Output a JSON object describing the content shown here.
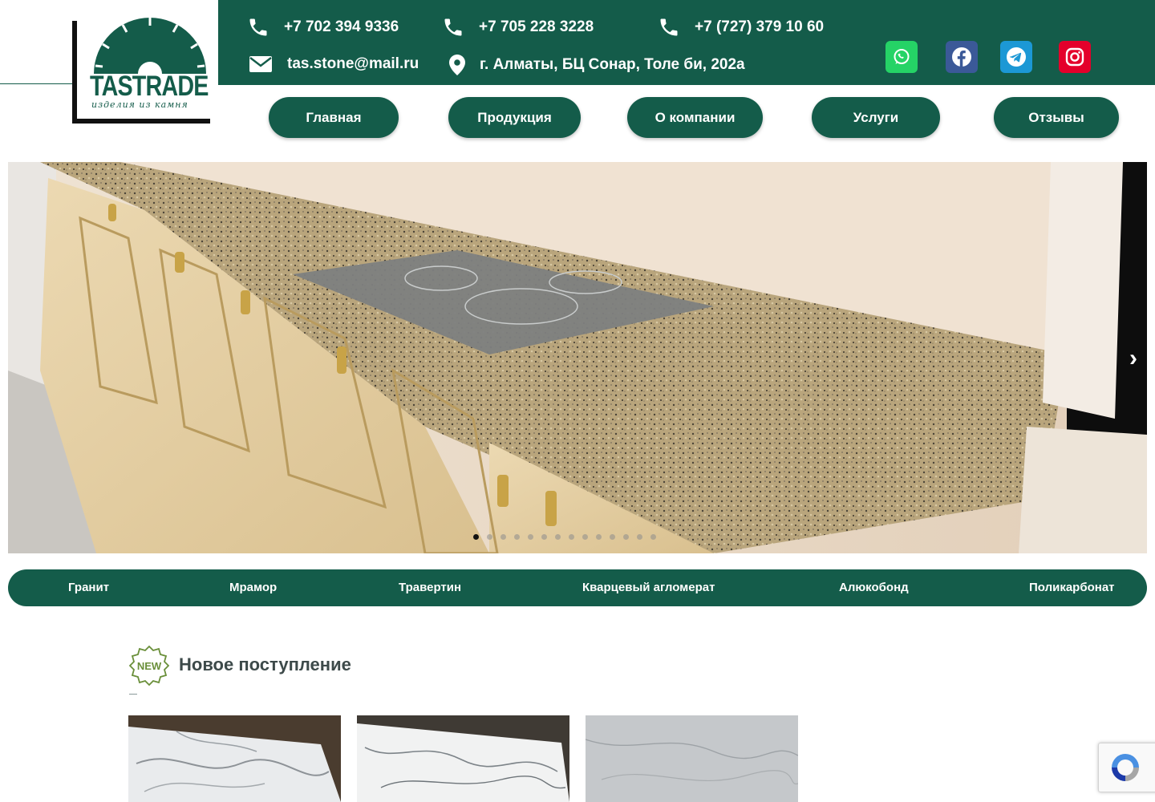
{
  "logo": {
    "brand": "TASTRADE",
    "tagline": "изделия из камня"
  },
  "contacts": {
    "phone1": "+7 702 394 9336",
    "phone2": "+7 705 228 3228",
    "phone3": "+7 (727) 379 10 60",
    "email": "tas.stone@mail.ru",
    "address": "г. Алматы, БЦ Сонар, Толе би, 202а"
  },
  "social": [
    {
      "icon": "whatsapp-icon",
      "color": "#25d366"
    },
    {
      "icon": "facebook-icon",
      "color": "#3b5998"
    },
    {
      "icon": "telegram-icon",
      "color": "#1c98d5"
    },
    {
      "icon": "instagram-icon",
      "color": "#e4002b"
    }
  ],
  "nav": {
    "home": "Главная",
    "products": "Продукция",
    "about": "О компании",
    "services": "Услуги",
    "reviews": "Отзывы"
  },
  "hero": {
    "slide_count": 14,
    "active_slide": 1,
    "next_icon": "chevron-right-icon"
  },
  "categories": {
    "granite": "Гранит",
    "marble": "Мрамор",
    "travertine": "Травертин",
    "quartz": "Кварцевый агломерат",
    "alucobond": "Алюкобонд",
    "polygal": "Поликарбонат"
  },
  "new_section": {
    "title": "Новое поступление",
    "badge": "NEW"
  },
  "colors": {
    "brand_green": "#145c4a",
    "white": "#ffffff"
  }
}
